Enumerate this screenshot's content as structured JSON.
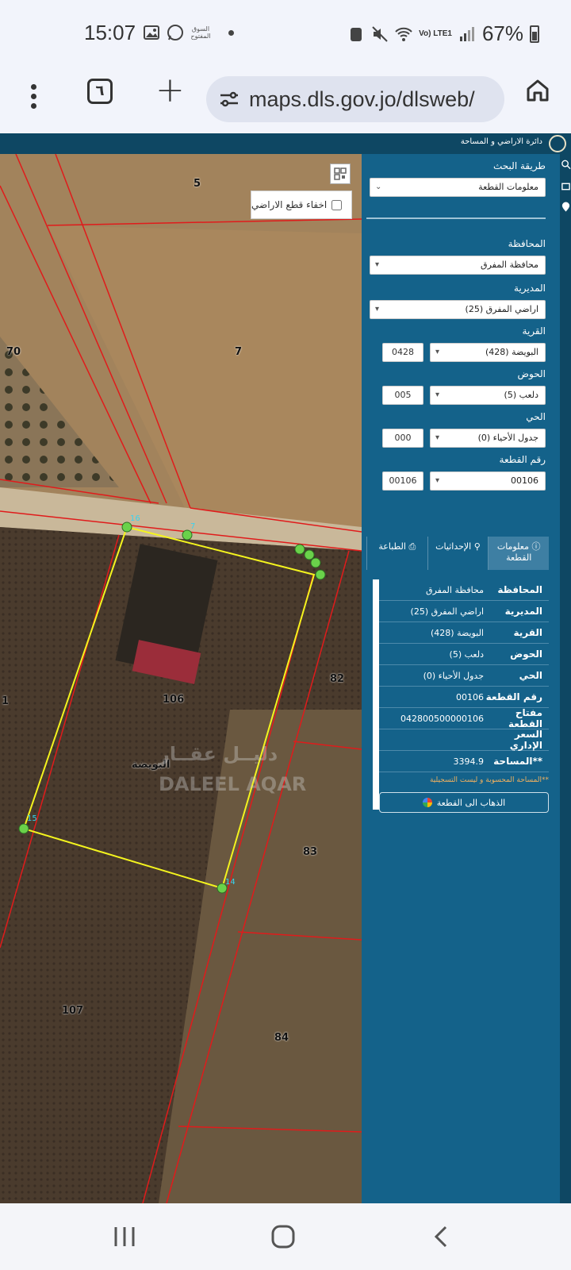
{
  "status_bar": {
    "time": "15:07",
    "app_badge": "السوق المفتوح",
    "lte": "Vo) LTE1",
    "battery": "67%"
  },
  "browser": {
    "tab_count": "٦",
    "url": "maps.dls.gov.jo/dlsweb/"
  },
  "site": {
    "header_title": "دائرة الاراضي و المساحة"
  },
  "map": {
    "hide_parcels_label": "اخفاء قطع الاراضي",
    "parcel_labels": [
      {
        "text": "5"
      },
      {
        "text": "70"
      },
      {
        "text": "7"
      },
      {
        "text": "82"
      },
      {
        "text": "106"
      },
      {
        "text": "1"
      },
      {
        "text": "83"
      },
      {
        "text": "107"
      },
      {
        "text": "84"
      }
    ],
    "village_label": "البويضة",
    "vertex_labels": [
      "16",
      "7",
      "15",
      "14"
    ],
    "watermark_ar": "دليــل عقــار",
    "watermark_en": "DALEEL AQAR"
  },
  "panel": {
    "search_method_label": "طريقة البحث",
    "search_method_value": "معلومات القطعة",
    "governorate_label": "المحافظة",
    "governorate_value": "محافظة المفرق",
    "directorate_label": "المديرية",
    "directorate_value": "اراضي المفرق (25)",
    "village_label": "القرية",
    "village_value": "البويضة (428)",
    "village_code": "0428",
    "basin_label": "الحوض",
    "basin_value": "دلعب (5)",
    "basin_code": "005",
    "neighborhood_label": "الحي",
    "neighborhood_value": "جدول الأحياء (0)",
    "neighborhood_code": "000",
    "parcel_no_label": "رقم القطعة",
    "parcel_no_value": "00106",
    "parcel_no_code": "00106"
  },
  "tabs": [
    {
      "label": "معلومات القطعة"
    },
    {
      "label": "الإحداثيات"
    },
    {
      "label": "الطباعة"
    }
  ],
  "info": {
    "rows": [
      {
        "key": "المحافظة",
        "value": "محافظة المفرق"
      },
      {
        "key": "المديرية",
        "value": "اراضي المفرق (25)"
      },
      {
        "key": "القرية",
        "value": "البويضة (428)"
      },
      {
        "key": "الحوض",
        "value": "دلعب (5)"
      },
      {
        "key": "الحي",
        "value": "جدول الأحياء (0)"
      },
      {
        "key": "رقم القطعة",
        "value": "00106"
      },
      {
        "key": "مفتاح القطعة",
        "value": "042800500000106"
      },
      {
        "key": "السعر الإداري",
        "value": ""
      },
      {
        "key": "**المساحة",
        "value": "3394.9"
      }
    ],
    "note": "**المساحة المحسوبة و ليست التسجيلية",
    "goto_button": "الذهاب الى القطعة"
  }
}
